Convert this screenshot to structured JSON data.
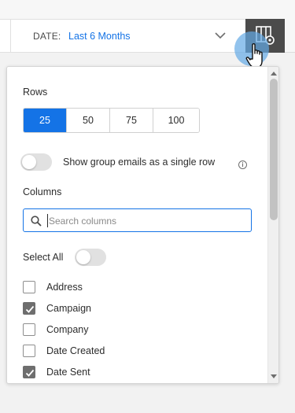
{
  "toolbar": {
    "date_label": "DATE:",
    "date_value": "Last 6 Months",
    "chevron_icon": "chevron-down-icon",
    "column_settings_icon": "column-settings-icon"
  },
  "panel": {
    "rows_title": "Rows",
    "row_options": [
      "25",
      "50",
      "75",
      "100"
    ],
    "selected_row_option": "25",
    "group_emails_label": "Show group emails as a single row",
    "group_emails_on": false,
    "columns_title": "Columns",
    "search": {
      "placeholder": "Search columns",
      "value": ""
    },
    "select_all_label": "Select All",
    "select_all_on": false,
    "columns": [
      {
        "label": "Address",
        "checked": false
      },
      {
        "label": "Campaign",
        "checked": true
      },
      {
        "label": "Company",
        "checked": false
      },
      {
        "label": "Date Created",
        "checked": false
      },
      {
        "label": "Date Sent",
        "checked": true
      }
    ]
  },
  "colors": {
    "accent": "#1473e6",
    "dark_button": "#4b4b4b",
    "checked_box": "#6e6e6e"
  }
}
